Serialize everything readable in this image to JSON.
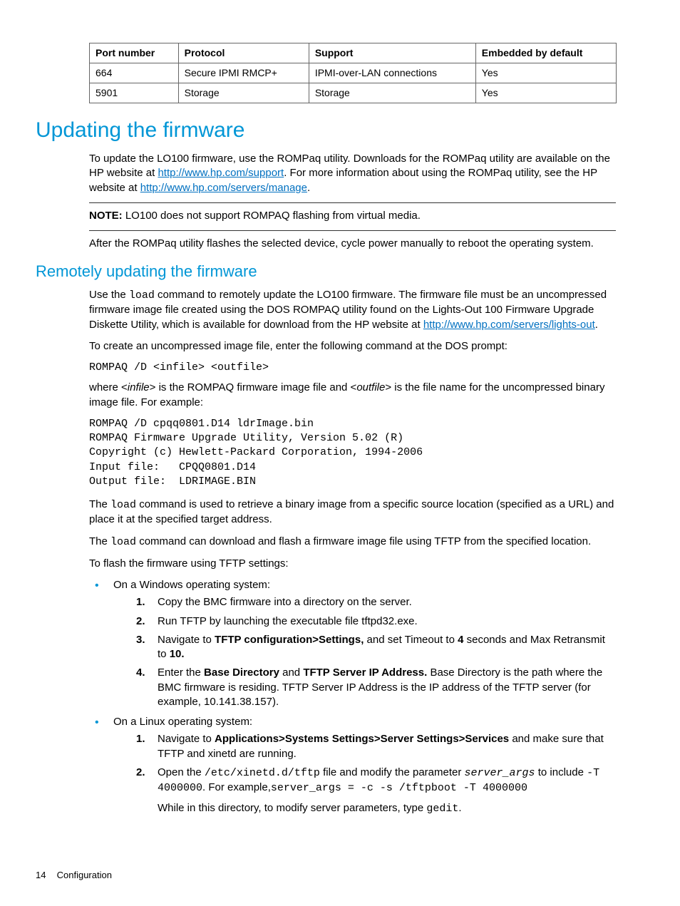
{
  "table": {
    "headers": [
      "Port number",
      "Protocol",
      "Support",
      "Embedded by default"
    ],
    "rows": [
      [
        "664",
        "Secure IPMI RMCP+",
        "IPMI-over-LAN connections",
        "Yes"
      ],
      [
        "5901",
        "Storage",
        "Storage",
        "Yes"
      ]
    ]
  },
  "h1": "Updating the firmware",
  "p1a": "To update the LO100 firmware, use the ROMPaq utility. Downloads for the ROMPaq utility are available on the HP website at ",
  "link1": "http://www.hp.com/support",
  "p1b": ". For more information about using the ROMPaq utility, see the HP website at ",
  "link2": "http://www.hp.com/servers/manage",
  "p1c": ".",
  "noteLabel": "NOTE:",
  "noteText": "   LO100 does not support ROMPAQ flashing from virtual media.",
  "p2": "After the ROMPaq utility flashes the selected device, cycle power manually to reboot the operating system.",
  "h2": "Remotely updating the firmware",
  "p3a": "Use the ",
  "p3code": "load",
  "p3b": " command to remotely update the LO100 firmware. The firmware file must be an uncompressed firmware image file created using the DOS ROMPAQ utility found on the Lights-Out 100 Firmware Upgrade Diskette Utility, which is available for download from the HP website at ",
  "link3": "http://www.hp.com/servers/lights-out",
  "p3c": ".",
  "p4": "To create an uncompressed image file, enter the following command at the DOS prompt:",
  "cmd1": "ROMPAQ /D <infile> <outfile>",
  "p5a": "where <",
  "p5i1": "infile",
  "p5b": "> is the ROMPAQ firmware image file and <",
  "p5i2": "outfile",
  "p5c": "> is the file name for the uncompressed binary image file. For example:",
  "block1": "ROMPAQ /D cpqq0801.D14 ldrImage.bin\nROMPAQ Firmware Upgrade Utility, Version 5.02 (R)\nCopyright (c) Hewlett-Packard Corporation, 1994-2006\nInput file:   CPQQ0801.D14\nOutput file:  LDRIMAGE.BIN",
  "p6a": "The ",
  "p6code": "load",
  "p6b": " command is used to retrieve a binary image from a specific source location (specified as a URL) and place it at the specified target address.",
  "p7a": "The ",
  "p7code": "load",
  "p7b": " command can download and flash a firmware image file using TFTP from the specified location.",
  "p8": "To flash the firmware using TFTP settings:",
  "winHeader": "On a Windows operating system:",
  "win1": "Copy the BMC firmware into a directory on the server.",
  "win2": "Run TFTP by launching the executable file tftpd32.exe.",
  "win3a": "Navigate to ",
  "win3b": "TFTP configuration>Settings,",
  "win3c": " and set Timeout to ",
  "win3d": "4",
  "win3e": " seconds and Max Retransmit to ",
  "win3f": "10.",
  "win4a": "Enter the ",
  "win4b": "Base Directory",
  "win4c": " and ",
  "win4d": "TFTP Server IP Address.",
  "win4e": " Base Directory is the path where the BMC firmware is residing. TFTP Server IP Address is the IP address of the TFTP server (for example, 10.141.38.157).",
  "linHeader": "On a Linux operating system:",
  "lin1a": "Navigate to ",
  "lin1b": "Applications>Systems Settings>Server Settings>Services",
  "lin1c": " and make sure that TFTP and xinetd are running.",
  "lin2a": "Open the ",
  "lin2code1": "/etc/xinetd.d/tftp",
  "lin2b": " file and modify the parameter ",
  "lin2code2": "server_args",
  "lin2c": " to include ",
  "lin2code3": "-T 4000000",
  "lin2d": ". For example,",
  "lin2code4": "server_args = -c -s /tftpboot -T 4000000",
  "lin2e": "While in this directory, to modify server parameters, type ",
  "lin2code5": "gedit",
  "lin2f": ".",
  "footerPage": "14",
  "footerText": "Configuration"
}
